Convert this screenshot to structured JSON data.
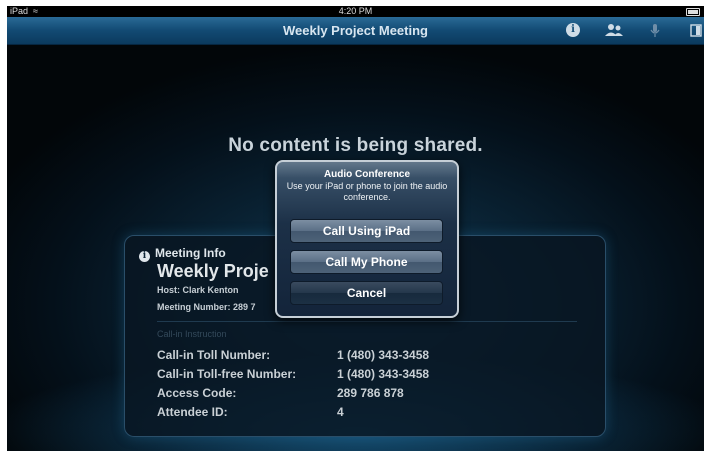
{
  "status_bar": {
    "device": "iPad",
    "time": "4:20 PM",
    "wifi_icon": "wifi-icon",
    "battery_icon": "battery-icon"
  },
  "nav_bar": {
    "title": "Weekly Project Meeting",
    "icons": [
      "info-icon",
      "participants-icon",
      "microphone-icon",
      "panel-icon"
    ]
  },
  "main": {
    "no_content_message": "No content is being shared."
  },
  "meeting_info": {
    "header": "Meeting Info",
    "meeting_name": "Weekly Proje",
    "host": "Host: Clark Kenton",
    "meeting_number": "Meeting Number: 289 7",
    "callin_section_title": "Call-in Instruction",
    "rows": [
      {
        "label": "Call-in Toll Number:",
        "value": "1 (480) 343-3458"
      },
      {
        "label": "Call-in Toll-free Number:",
        "value": "1 (480) 343-3458"
      },
      {
        "label": "Access Code:",
        "value": "289 786 878"
      },
      {
        "label": "Attendee ID:",
        "value": "4"
      }
    ]
  },
  "dialog": {
    "title": "Audio Conference",
    "message": "Use your iPad or phone to join the audio conference.",
    "buttons": {
      "call_ipad": "Call Using iPad",
      "call_phone": "Call My Phone",
      "cancel": "Cancel"
    }
  },
  "colors": {
    "nav_bar": "#124a73",
    "background": "#04101a",
    "dialog_border": "#c6cfd7"
  }
}
